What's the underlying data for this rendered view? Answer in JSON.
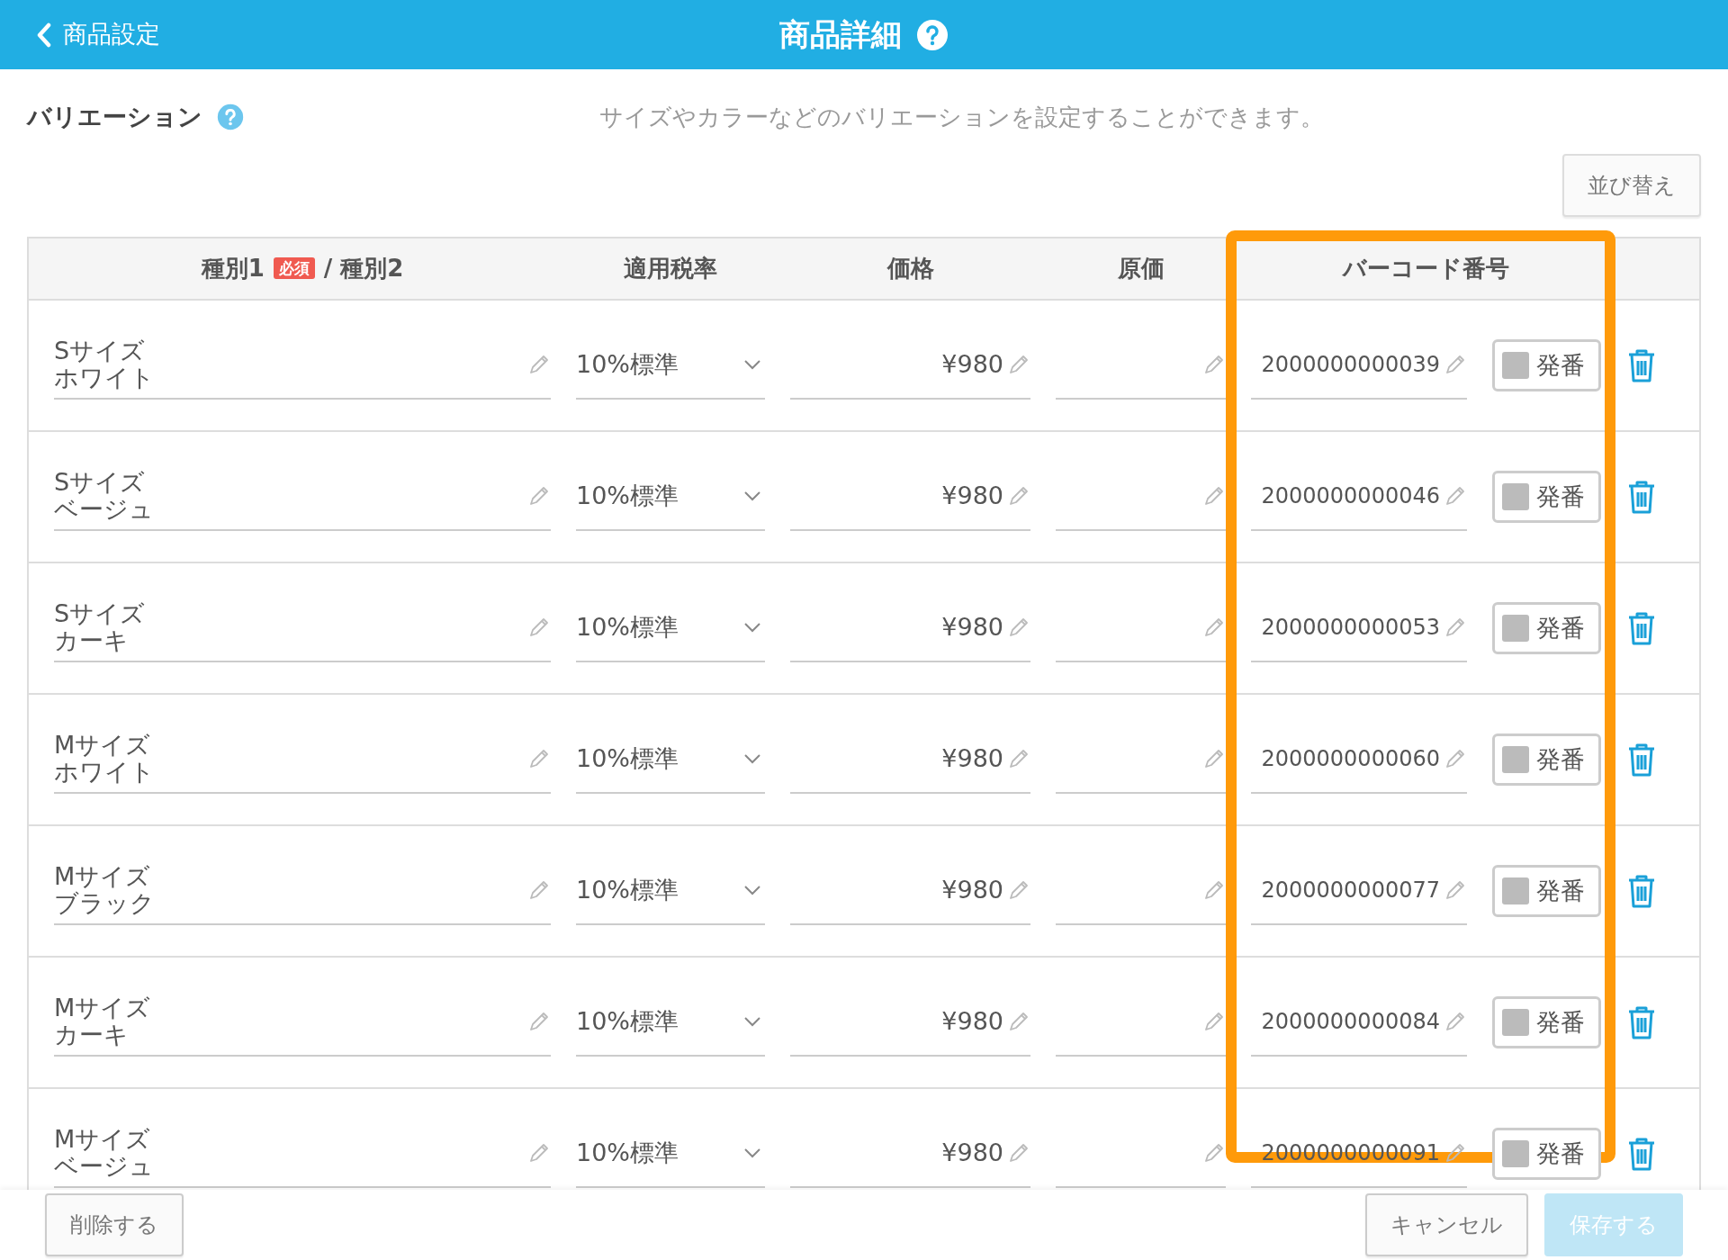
{
  "header": {
    "back_label": "商品設定",
    "title": "商品詳細"
  },
  "section": {
    "title": "バリエーション",
    "description": "サイズやカラーなどのバリエーションを設定することができます。"
  },
  "sort_button": "並び替え",
  "table": {
    "columns": [
      {
        "label": "種別1",
        "badge": "必須",
        "label_after": "/ 種別2"
      },
      {
        "label": "適用税率"
      },
      {
        "label": "価格"
      },
      {
        "label": "原価"
      },
      {
        "label": "バーコード番号"
      }
    ],
    "rows": [
      {
        "type1": "Sサイズ",
        "type2": "ホワイト",
        "tax": "10%標準",
        "price": "¥980",
        "barcode": "2000000000039",
        "issue_button": "発番"
      },
      {
        "type1": "Sサイズ",
        "type2": "ベージュ",
        "tax": "10%標準",
        "price": "¥980",
        "barcode": "2000000000046",
        "issue_button": "発番"
      },
      {
        "type1": "Sサイズ",
        "type2": "カーキ",
        "tax": "10%標準",
        "price": "¥980",
        "barcode": "2000000000053",
        "issue_button": "発番"
      },
      {
        "type1": "Mサイズ",
        "type2": "ホワイト",
        "tax": "10%標準",
        "price": "¥980",
        "barcode": "2000000000060",
        "issue_button": "発番"
      },
      {
        "type1": "Mサイズ",
        "type2": "ブラック",
        "tax": "10%標準",
        "price": "¥980",
        "barcode": "2000000000077",
        "issue_button": "発番"
      },
      {
        "type1": "Mサイズ",
        "type2": "カーキ",
        "tax": "10%標準",
        "price": "¥980",
        "barcode": "2000000000084",
        "issue_button": "発番"
      },
      {
        "type1": "Mサイズ",
        "type2": "ベージュ",
        "tax": "10%標準",
        "price": "¥980",
        "barcode": "2000000000091",
        "issue_button": "発番"
      }
    ]
  },
  "footer": {
    "buttons": [
      {
        "kind": "delete",
        "label": "削除する",
        "disabled": false
      },
      {
        "kind": "cancel",
        "label": "キャンセル",
        "disabled": false
      },
      {
        "kind": "save",
        "label": "保存する",
        "disabled": true
      }
    ]
  }
}
